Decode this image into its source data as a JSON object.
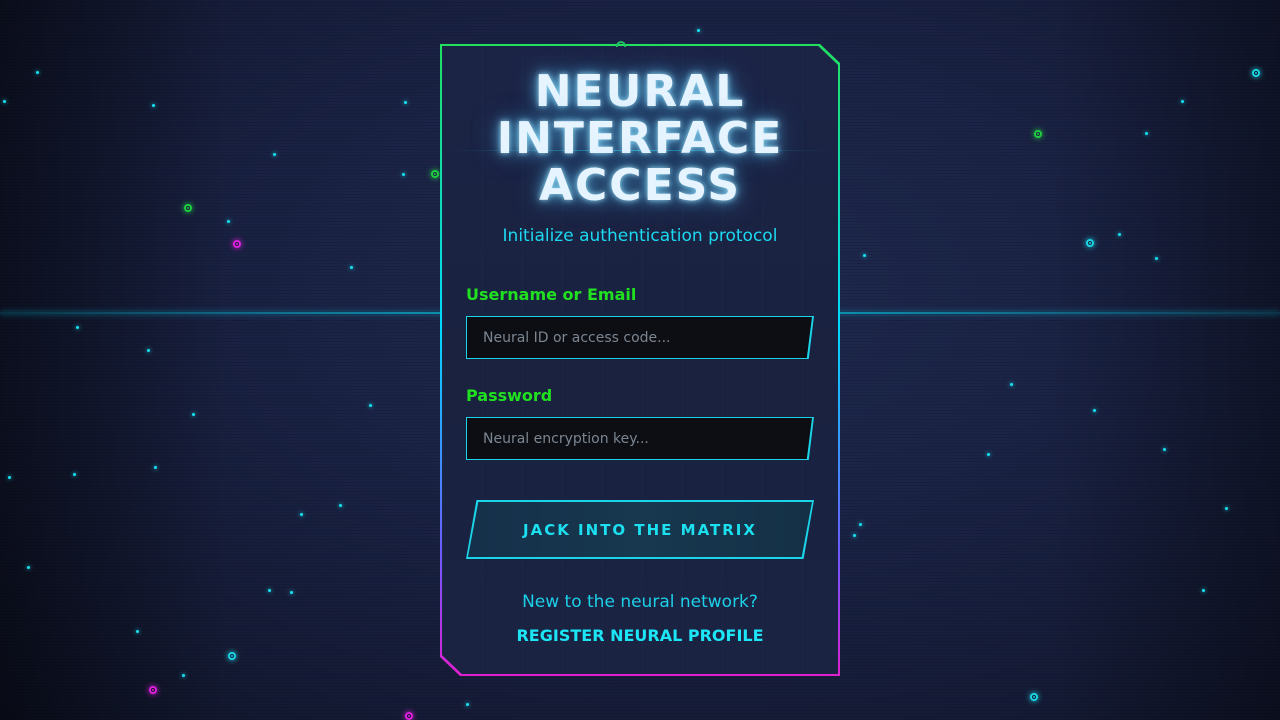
{
  "login": {
    "title": "NEURAL INTERFACE ACCESS",
    "subtitle": "Initialize authentication protocol",
    "username_label": "Username or Email",
    "username_placeholder": "Neural ID or access code...",
    "password_label": "Password",
    "password_placeholder": "Neural encryption key...",
    "submit_label": "JACK INTO THE MATRIX",
    "signup_prompt": "New to the neural network?",
    "register_label": "REGISTER NEURAL PROFILE"
  },
  "theme": {
    "accent_cyan": "#1cd8f0",
    "accent_green": "#20e020",
    "accent_magenta": "#e020d0",
    "background": "#1a2244"
  }
}
